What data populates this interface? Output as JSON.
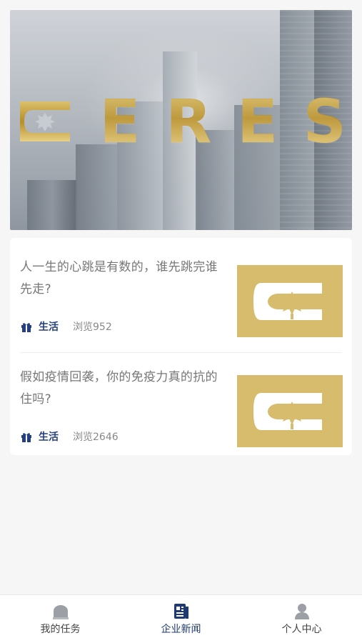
{
  "banner": {
    "brand_letters": [
      "E",
      "R",
      "E",
      "S"
    ]
  },
  "news": [
    {
      "title": "人一生的心跳是有数的，谁先跳完谁先走?",
      "category": "生活",
      "views_label": "浏览952"
    },
    {
      "title": "假如疫情回袭，你的免疫力真的抗的住吗?",
      "category": "生活",
      "views_label": "浏览2646"
    }
  ],
  "tabs": [
    {
      "label": "我的任务",
      "icon": "house-icon",
      "active": false
    },
    {
      "label": "企业新闻",
      "icon": "news-icon",
      "active": true
    },
    {
      "label": "个人中心",
      "icon": "user-icon",
      "active": false
    }
  ],
  "colors": {
    "accent": "#233f7f",
    "gold": "#d6bc6c",
    "text": "#777777"
  }
}
